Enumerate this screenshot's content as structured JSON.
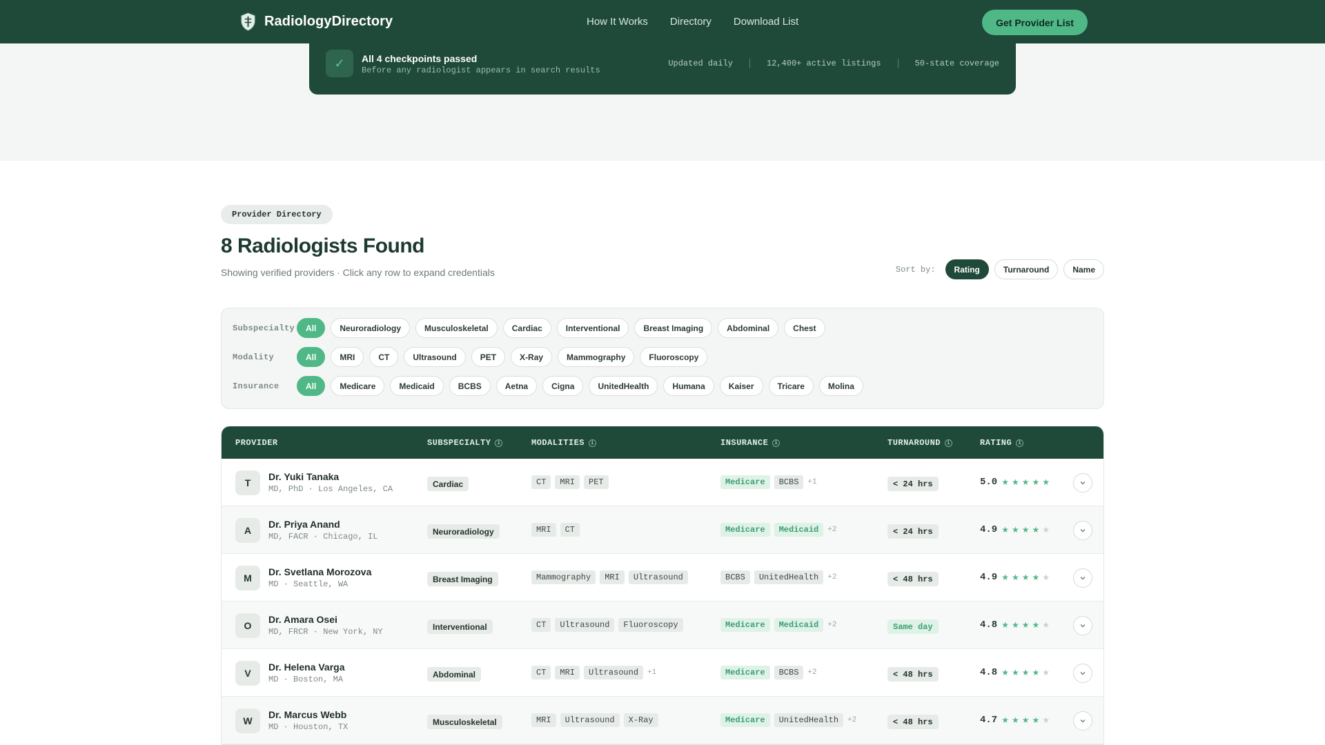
{
  "nav": {
    "brand": "RadiologyDirectory",
    "links": [
      "How It Works",
      "Directory",
      "Download List"
    ],
    "cta": "Get Provider List"
  },
  "banner": {
    "title": "All 4 checkpoints passed",
    "subtitle": "Before any radiologist appears in search results",
    "stats": [
      "Updated daily",
      "12,400+ active listings",
      "50-state coverage"
    ]
  },
  "section": {
    "pill": "Provider Directory",
    "title": "8 Radiologists Found",
    "subtitle": "Showing verified providers · Click any row to expand credentials"
  },
  "sort": {
    "label": "Sort by:",
    "options": [
      "Rating",
      "Turnaround",
      "Name"
    ],
    "active": "Rating"
  },
  "filters": [
    {
      "label": "Subspecialty",
      "options": [
        "All",
        "Neuroradiology",
        "Musculoskeletal",
        "Cardiac",
        "Interventional",
        "Breast Imaging",
        "Abdominal",
        "Chest"
      ]
    },
    {
      "label": "Modality",
      "options": [
        "All",
        "MRI",
        "CT",
        "Ultrasound",
        "PET",
        "X-Ray",
        "Mammography",
        "Fluoroscopy"
      ]
    },
    {
      "label": "Insurance",
      "options": [
        "All",
        "Medicare",
        "Medicaid",
        "BCBS",
        "Aetna",
        "Cigna",
        "UnitedHealth",
        "Humana",
        "Kaiser",
        "Tricare",
        "Molina"
      ]
    }
  ],
  "table": {
    "headers": [
      "PROVIDER",
      "SUBSPECIALTY",
      "MODALITIES",
      "INSURANCE",
      "TURNAROUND",
      "RATING"
    ],
    "rows": [
      {
        "initial": "T",
        "name": "Dr. Yuki Tanaka",
        "meta": "MD, PhD · Los Angeles, CA",
        "subspecialty": "Cardiac",
        "modalities": [
          "CT",
          "MRI",
          "PET"
        ],
        "modalities_more": "",
        "insurance": [
          "Medicare",
          "BCBS"
        ],
        "insurance_green": [
          true,
          false
        ],
        "insurance_more": "+1",
        "turnaround": "< 24 hrs",
        "turnaround_green": false,
        "rating": "5.0",
        "stars": 5
      },
      {
        "initial": "A",
        "name": "Dr. Priya Anand",
        "meta": "MD, FACR · Chicago, IL",
        "subspecialty": "Neuroradiology",
        "modalities": [
          "MRI",
          "CT"
        ],
        "modalities_more": "",
        "insurance": [
          "Medicare",
          "Medicaid"
        ],
        "insurance_green": [
          true,
          true
        ],
        "insurance_more": "+2",
        "turnaround": "< 24 hrs",
        "turnaround_green": false,
        "rating": "4.9",
        "stars": 4
      },
      {
        "initial": "M",
        "name": "Dr. Svetlana Morozova",
        "meta": "MD · Seattle, WA",
        "subspecialty": "Breast Imaging",
        "modalities": [
          "Mammography",
          "MRI",
          "Ultrasound"
        ],
        "modalities_more": "",
        "insurance": [
          "BCBS",
          "UnitedHealth"
        ],
        "insurance_green": [
          false,
          false
        ],
        "insurance_more": "+2",
        "turnaround": "< 48 hrs",
        "turnaround_green": false,
        "rating": "4.9",
        "stars": 4
      },
      {
        "initial": "O",
        "name": "Dr. Amara Osei",
        "meta": "MD, FRCR · New York, NY",
        "subspecialty": "Interventional",
        "modalities": [
          "CT",
          "Ultrasound",
          "Fluoroscopy"
        ],
        "modalities_more": "",
        "insurance": [
          "Medicare",
          "Medicaid"
        ],
        "insurance_green": [
          true,
          true
        ],
        "insurance_more": "+2",
        "turnaround": "Same day",
        "turnaround_green": true,
        "rating": "4.8",
        "stars": 4
      },
      {
        "initial": "V",
        "name": "Dr. Helena Varga",
        "meta": "MD · Boston, MA",
        "subspecialty": "Abdominal",
        "modalities": [
          "CT",
          "MRI",
          "Ultrasound"
        ],
        "modalities_more": "+1",
        "insurance": [
          "Medicare",
          "BCBS"
        ],
        "insurance_green": [
          true,
          false
        ],
        "insurance_more": "+2",
        "turnaround": "< 48 hrs",
        "turnaround_green": false,
        "rating": "4.8",
        "stars": 4
      },
      {
        "initial": "W",
        "name": "Dr. Marcus Webb",
        "meta": "MD · Houston, TX",
        "subspecialty": "Musculoskeletal",
        "modalities": [
          "MRI",
          "Ultrasound",
          "X-Ray"
        ],
        "modalities_more": "",
        "insurance": [
          "Medicare",
          "UnitedHealth"
        ],
        "insurance_green": [
          true,
          false
        ],
        "insurance_more": "+2",
        "turnaround": "< 48 hrs",
        "turnaround_green": false,
        "rating": "4.7",
        "stars": 4
      }
    ]
  },
  "colors": {
    "primary": "#1f4a39",
    "accent": "#4fb886",
    "star_on": "#4fb886",
    "star_off": "#c9d1cd"
  },
  "icons": {
    "brand": "shield-icon",
    "banner": "check-icon",
    "info": "info-icon",
    "expand": "chevron-down-icon",
    "star": "star-icon"
  }
}
